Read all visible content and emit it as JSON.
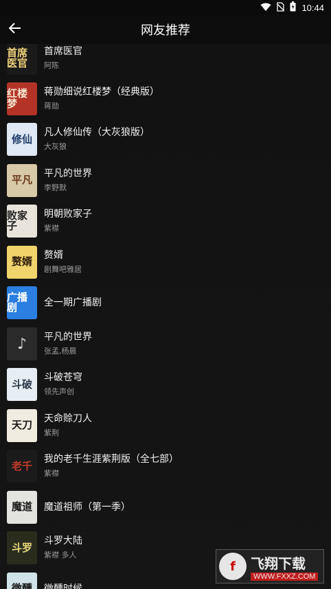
{
  "status_bar": {
    "time": "10:44"
  },
  "app_bar": {
    "title": "网友推荐"
  },
  "items": [
    {
      "title": "首席医官",
      "author": "阿陈",
      "cover_text": "首席医官",
      "cover_color": "#1a1a1a",
      "cover_fg": "#f1d27a"
    },
    {
      "title": "蒋勋细说红楼梦（经典版）",
      "author": "蒋勋",
      "cover_text": "红楼梦",
      "cover_color": "#b33426",
      "cover_fg": "#f4e5cf"
    },
    {
      "title": "凡人修仙传（大灰狼版）",
      "author": "大灰狼",
      "cover_text": "修仙",
      "cover_color": "#dfe8f3",
      "cover_fg": "#1f3d6b"
    },
    {
      "title": "平凡的世界",
      "author": "李野默",
      "cover_text": "平凡",
      "cover_color": "#d8c9a8",
      "cover_fg": "#6a3a1a"
    },
    {
      "title": "明朝败家子",
      "author": "紫襟",
      "cover_text": "败家子",
      "cover_color": "#e8e4dc",
      "cover_fg": "#222"
    },
    {
      "title": "赘婿",
      "author": "剧舞吧雅居",
      "cover_text": "赘婿",
      "cover_color": "#f0d36a",
      "cover_fg": "#2a1a0a"
    },
    {
      "title": "全一期广播剧",
      "author": "",
      "cover_text": "广播剧",
      "cover_color": "#2b7fe0",
      "cover_fg": "#ffffff"
    },
    {
      "title": "平凡的世界",
      "author": "张孟,杨晨",
      "cover_text": "♪",
      "cover_color": "#2a2a2a",
      "cover_fg": "#cfcfcf"
    },
    {
      "title": "斗破苍穹",
      "author": "领先声创",
      "cover_text": "斗破",
      "cover_color": "#e7eef3",
      "cover_fg": "#2a3a4a"
    },
    {
      "title": "天命赊刀人",
      "author": "紫荆",
      "cover_text": "天刀",
      "cover_color": "#f1ece0",
      "cover_fg": "#1a1a1a"
    },
    {
      "title": "我的老千生涯紫荆版（全七部）",
      "author": "紫襟",
      "cover_text": "老千",
      "cover_color": "#1b1b1b",
      "cover_fg": "#c13a2a"
    },
    {
      "title": "魔道祖师（第一季）",
      "author": "",
      "cover_text": "魔道",
      "cover_color": "#e3e3df",
      "cover_fg": "#1a1a1a"
    },
    {
      "title": "斗罗大陆",
      "author": "紫襟 多人",
      "cover_text": "斗罗",
      "cover_color": "#2a2d1e",
      "cover_fg": "#e9d77a"
    },
    {
      "title": "微醺时候",
      "author": "",
      "cover_text": "微醺",
      "cover_color": "#cfe3e8",
      "cover_fg": "#1a1a1a"
    }
  ],
  "watermark": {
    "name": "飞翔下载",
    "url": "WWW.FXXZ.COM"
  },
  "icons": [
    "wifi-icon",
    "no-sim-icon",
    "battery-icon",
    "back-arrow-icon",
    "music-note-icon"
  ]
}
